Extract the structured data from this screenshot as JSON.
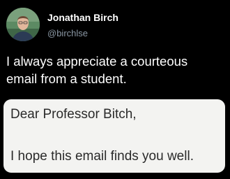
{
  "author": {
    "display_name": "Jonathan Birch",
    "handle": "@birchlse"
  },
  "tweet": {
    "line1": "I always appreciate a courteous",
    "line2": "email from a student."
  },
  "email_screenshot": {
    "greeting": "Dear Professor Bitch,",
    "body": "I hope this email finds you well."
  },
  "colors": {
    "background": "#000000",
    "text": "#ffffff",
    "handle": "#8b98a5",
    "card_background": "#f3f3f1",
    "card_text": "#2a2a2a"
  }
}
